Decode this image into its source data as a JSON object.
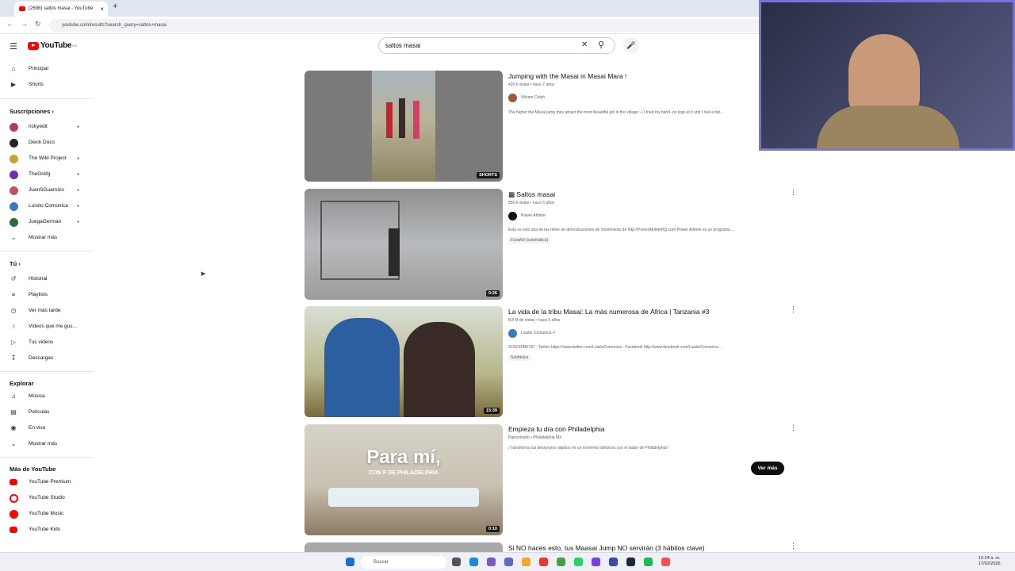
{
  "browser": {
    "tab_title": "(2698) saltos masai - YouTube",
    "tab_close": "×",
    "new_tab": "+",
    "url": "youtube.com/results?search_query=saltos+masai"
  },
  "header": {
    "logo_text": "YouTube",
    "logo_region": "MX",
    "search_value": "saltos masai"
  },
  "sidebar": {
    "main": [
      {
        "label": "Principal",
        "icon": "home-icon"
      },
      {
        "label": "Shorts",
        "icon": "shorts-icon"
      }
    ],
    "subs_heading": "Suscripciones",
    "subscriptions": [
      {
        "label": "rickyedit",
        "color": "#b03a6f"
      },
      {
        "label": "Dieck Docs",
        "color": "#222222"
      },
      {
        "label": "The Wild Project",
        "color": "#c9a227"
      },
      {
        "label": "TheGrefg",
        "color": "#6d2fb3"
      },
      {
        "label": "JuanSGuarnizo",
        "color": "#c0506a"
      },
      {
        "label": "Luisito Comunica",
        "color": "#3a7bbf"
      },
      {
        "label": "JuegaGerman",
        "color": "#2e6b3e"
      }
    ],
    "subs_more": "Mostrar más",
    "you_heading": "Tú",
    "you_items": [
      {
        "label": "Historial",
        "icon": "history-icon"
      },
      {
        "label": "Playlists",
        "icon": "playlist-icon"
      },
      {
        "label": "Ver más tarde",
        "icon": "clock-icon"
      },
      {
        "label": "Videos que me gus...",
        "icon": "like-icon"
      },
      {
        "label": "Tus videos",
        "icon": "video-icon"
      },
      {
        "label": "Descargas",
        "icon": "download-icon"
      }
    ],
    "explore_heading": "Explorar",
    "explore_items": [
      {
        "label": "Música",
        "icon": "music-icon"
      },
      {
        "label": "Películas",
        "icon": "film-icon"
      },
      {
        "label": "En vivo",
        "icon": "live-icon"
      },
      {
        "label": "Mostrar más",
        "icon": "chevron-down-icon"
      }
    ],
    "more_heading": "Más de YouTube",
    "more_items": [
      {
        "label": "YouTube Premium",
        "color": "#ff0000"
      },
      {
        "label": "YouTube Studio",
        "color": "#ff0000"
      },
      {
        "label": "YouTube Music",
        "color": "#ff0000"
      },
      {
        "label": "YouTube Kids",
        "color": "#ff0000"
      }
    ]
  },
  "results": [
    {
      "title": "Jumping with the Masai in Masai Mara !",
      "meta": "420 k vistas • hace 7 años",
      "channel": "Vikram Cotah",
      "description": "The higher the Masai jump they attract the most beautiful girl in the village :-) I tried my hand -no legs at it and I had a fab...",
      "duration": "SHORTS",
      "badge": ""
    },
    {
      "title": "Saltos masai",
      "meta": "850 k vistas • hace 6 años",
      "channel": "Power Athlete",
      "description": "Esta es solo una de las miles de demostraciones de movimiento de http://PowerAthleteHQ.com Power Athlete es un programa ...",
      "duration": "0:26",
      "badge": "Español (automático)"
    },
    {
      "title": "La vida de la tribu Masai: La más numerosa de África | Tanzania #3",
      "meta": "8.8 M de vistas • hace 5 años",
      "channel": "Luisito Comunica",
      "description": "SUSCRIBETE! - Twitter https://www.twitter.com/LuisitoComunica - Facebook http://www.facebook.com/LuisitoComunica ...",
      "duration": "15:39",
      "badge": "Subtítulos"
    },
    {
      "title": "Empieza tu día con Philadelphia",
      "meta": "Patrocinado • Philadelphia MX",
      "channel": "",
      "description": "¡Transforma tus desayunos rápidos en un momento delicioso con el sabor de Philadelphia!",
      "duration": "0:10",
      "badge": "",
      "cta": "Ver más",
      "overlay": "Para mí,",
      "overlay_sub": "CON P DE PHILADELPHIA"
    },
    {
      "title": "Si NO haces esto, tus Maasai Jump NO servirán (3 hábitos clave)",
      "meta": "",
      "channel": "",
      "description": "",
      "duration": "",
      "badge": ""
    }
  ],
  "taskbar": {
    "search_placeholder": "Buscar",
    "time": "12:24 a. m.",
    "date": "17/02/2026"
  },
  "colors": {
    "brand_red": "#ff0000",
    "webcam_frame": "#7b6fd8"
  }
}
